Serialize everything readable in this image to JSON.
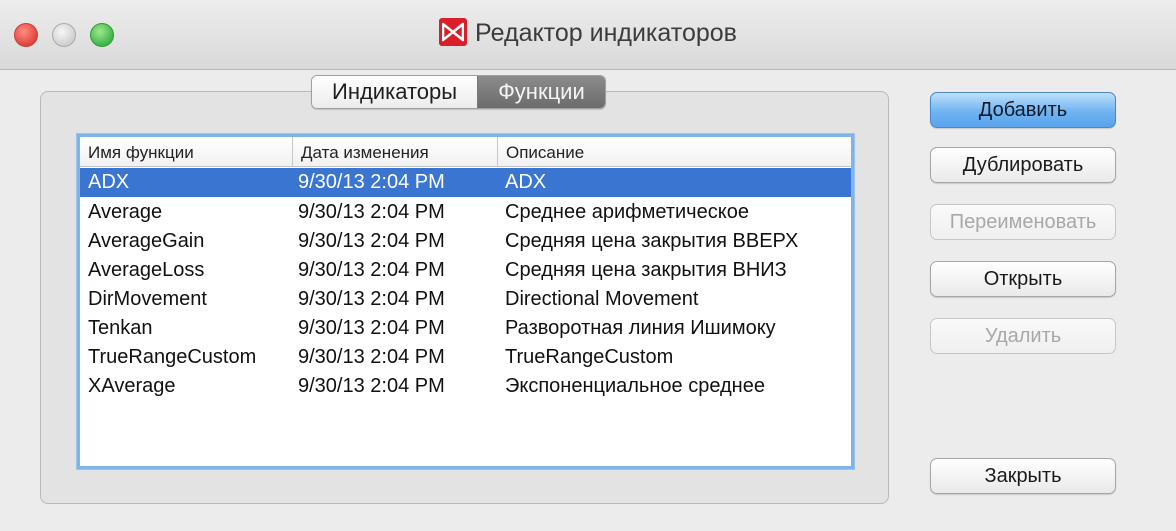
{
  "window": {
    "title": "Редактор индикаторов"
  },
  "tabs": [
    {
      "label": "Индикаторы",
      "active": false
    },
    {
      "label": "Функции",
      "active": true
    }
  ],
  "table": {
    "columns": [
      "Имя функции",
      "Дата изменения",
      "Описание"
    ],
    "rows": [
      {
        "name": "ADX",
        "date": "9/30/13 2:04 PM",
        "description": "ADX",
        "selected": true
      },
      {
        "name": "Average",
        "date": "9/30/13 2:04 PM",
        "description": "Среднее арифметическое"
      },
      {
        "name": "AverageGain",
        "date": "9/30/13 2:04 PM",
        "description": "Средняя цена закрытия ВВЕРХ"
      },
      {
        "name": "AverageLoss",
        "date": "9/30/13 2:04 PM",
        "description": "Средняя цена закрытия ВНИЗ"
      },
      {
        "name": "DirMovement",
        "date": "9/30/13 2:04 PM",
        "description": "Directional Movement"
      },
      {
        "name": "Tenkan",
        "date": "9/30/13 2:04 PM",
        "description": "Разворотная линия Ишимоку"
      },
      {
        "name": "TrueRangeCustom",
        "date": "9/30/13 2:04 PM",
        "description": "TrueRangeCustom"
      },
      {
        "name": "XAverage",
        "date": "9/30/13 2:04 PM",
        "description": "Экспоненциальное среднее"
      }
    ]
  },
  "buttons": {
    "add": "Добавить",
    "duplicate": "Дублировать",
    "rename": "Переименовать",
    "open": "Открыть",
    "delete": "Удалить",
    "close": "Закрыть"
  },
  "colors": {
    "selection": "#3a76d1",
    "default_button": "#6fb3f1",
    "app_icon": "#d9202a"
  },
  "icons": {
    "app": "app-logo-icon"
  }
}
